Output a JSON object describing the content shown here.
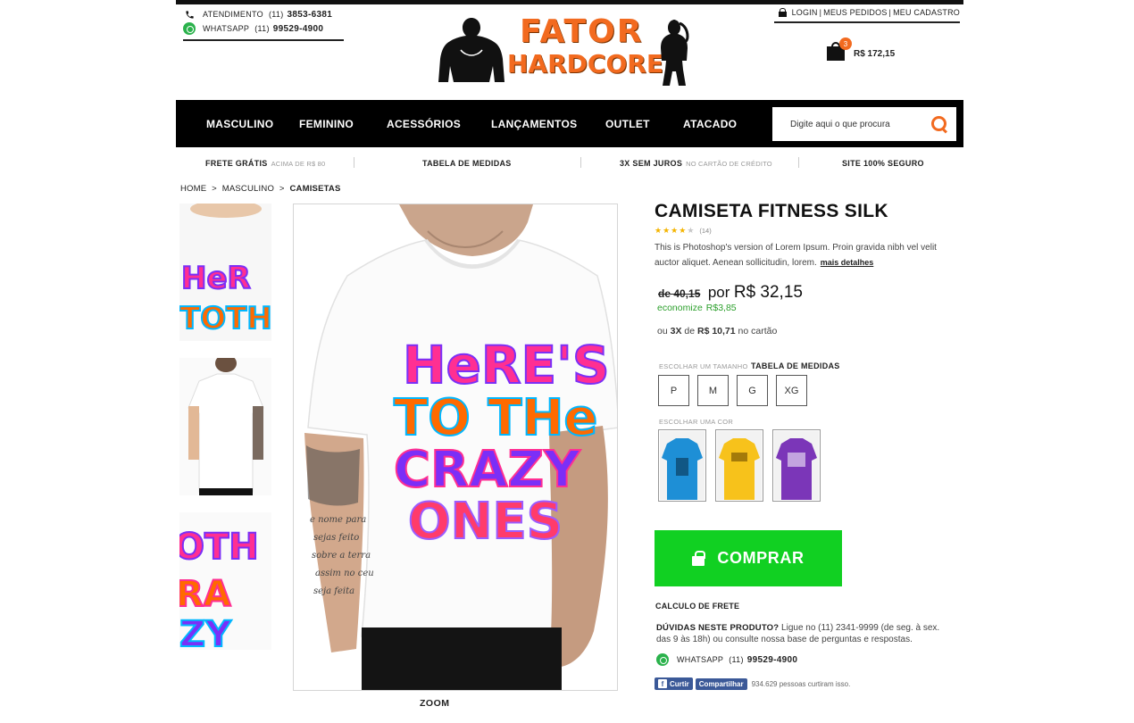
{
  "contact": {
    "atendimento_label": "ATENDIMENTO",
    "atendimento_ddd": "(11)",
    "atendimento_phone": "3853-6381",
    "whatsapp_label": "WHATSAPP",
    "whatsapp_ddd": "(11)",
    "whatsapp_phone": "99529-4900"
  },
  "logo": {
    "line1": "FATOR",
    "line2": "HARDCORE"
  },
  "account": {
    "login": "LOGIN",
    "pedidos": "MEUS PEDIDOS",
    "cadastro": "MEU CADASTRO",
    "sep": "|"
  },
  "cart": {
    "count": "3",
    "total": "R$ 172,15"
  },
  "nav": {
    "items": [
      "MASCULINO",
      "FEMININO",
      "ACESSÓRIOS",
      "LANÇAMENTOS",
      "OUTLET",
      "ATACADO"
    ],
    "search_placeholder": "Digite aqui o que procura"
  },
  "benefits": [
    {
      "title": "FRETE GRÁTIS",
      "sub": "ACIMA DE R$ 80"
    },
    {
      "title": "TABELA DE MEDIDAS",
      "sub": ""
    },
    {
      "title": "3X SEM JUROS",
      "sub": "NO CARTÃO DE CRÉDITO"
    },
    {
      "title": "SITE 100% SEGURO",
      "sub": ""
    }
  ],
  "breadcrumb": [
    "HOME",
    ">",
    "MASCULINO",
    ">",
    "CAMISETAS"
  ],
  "gallery": {
    "zoom": "ZOOM"
  },
  "artwork": {
    "l1": "HeRE'S",
    "l2": "TO THe",
    "l3": "CRAZY",
    "l4": "ONES"
  },
  "product": {
    "title": "CAMISETA FITNESS SILK",
    "rating": 4,
    "rating_count": "(14)",
    "description": "This is Photoshop's version  of Lorem Ipsum. Proin gravida nibh vel velit auctor aliquet. Aenean sollicitudin, lorem.",
    "more": "mais detalhes",
    "old_price": "de 40,15",
    "por": "por",
    "price": "R$ 32,15",
    "economize_label": "economize",
    "economize_value": "R$3,85",
    "installments_pre": "ou",
    "installments_count": "3X",
    "installments_de": "de",
    "installments_value": "R$ 10,71",
    "installments_post": "no cartão",
    "size_label": "ESCOLHAR UM TAMANHO",
    "size_table": "TABELA DE MEDIDAS",
    "sizes": [
      "P",
      "M",
      "G",
      "XG"
    ],
    "color_label": "ESCOLHAR UMA COR",
    "colors": [
      "#1e8fd6",
      "#f7c21b",
      "#7b36b8"
    ],
    "buy": "COMPRAR",
    "frete": "CALCULO DE FRETE",
    "duvidas_title": "DÚVIDAS NESTE PRODUTO?",
    "duvidas_text": "Ligue no (11) 2341-9999 (de seg. à sex. das 9 às 18h) ou consulte nossa base de perguntas e respostas.",
    "whatsapp_label": "WHATSAPP",
    "whatsapp_ddd": "(11)",
    "whatsapp_phone": "99529-4900",
    "fb_like": "Curtir",
    "fb_share": "Compartilhar",
    "fb_count": "934.629 pessoas curtiram isso."
  },
  "theme": {
    "accent": "#f26a1f",
    "buy": "#11d022",
    "nav_bg": "#000000",
    "green_text": "#2b9f2b"
  }
}
